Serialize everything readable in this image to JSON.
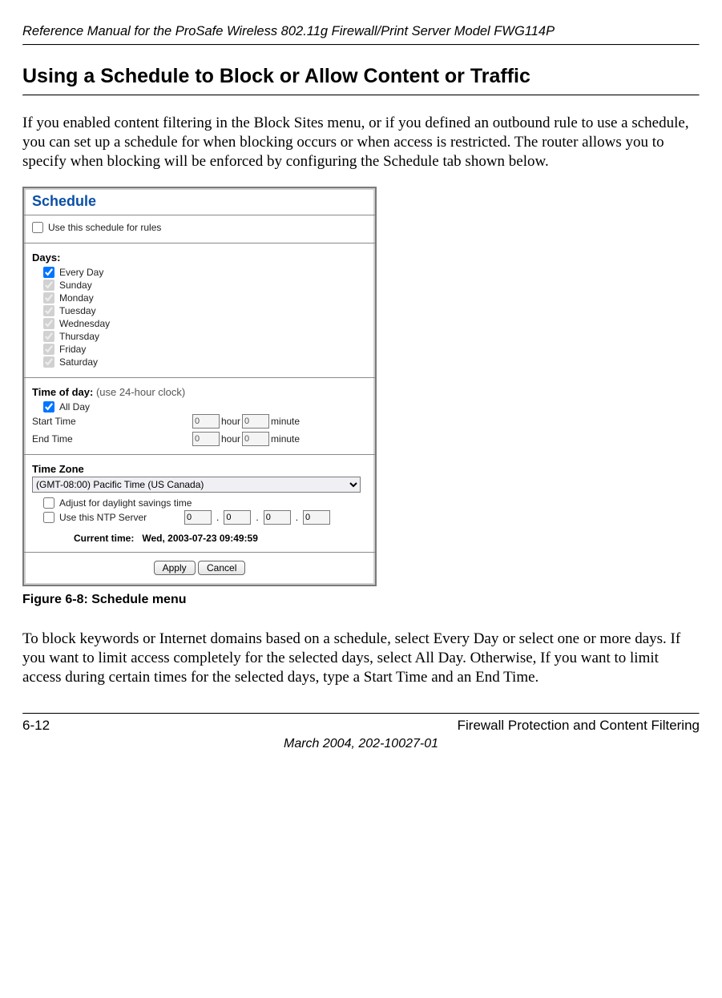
{
  "header": {
    "title": "Reference Manual for the ProSafe Wireless 802.11g  Firewall/Print Server Model FWG114P"
  },
  "section": {
    "heading": "Using a Schedule to Block or Allow Content or Traffic"
  },
  "intro": "If you enabled content filtering in the Block Sites menu, or if you defined an outbound rule to use a schedule, you can set up a schedule for when blocking occurs or when access is restricted. The router allows you to specify when blocking will be enforced by configuring the Schedule tab shown below.",
  "screenshot": {
    "title": "Schedule",
    "use_rule_label": "Use this schedule for rules",
    "use_rule_checked": false,
    "days_header": "Days:",
    "days": [
      {
        "label": "Every Day",
        "checked": true,
        "disabled": false
      },
      {
        "label": "Sunday",
        "checked": true,
        "disabled": true
      },
      {
        "label": "Monday",
        "checked": true,
        "disabled": true
      },
      {
        "label": "Tuesday",
        "checked": true,
        "disabled": true
      },
      {
        "label": "Wednesday",
        "checked": true,
        "disabled": true
      },
      {
        "label": "Thursday",
        "checked": true,
        "disabled": true
      },
      {
        "label": "Friday",
        "checked": true,
        "disabled": true
      },
      {
        "label": "Saturday",
        "checked": true,
        "disabled": true
      }
    ],
    "tod_header": "Time of day:",
    "tod_note": "(use 24-hour clock)",
    "allday_label": "All Day",
    "allday_checked": true,
    "start_label": "Start Time",
    "end_label": "End Time",
    "hour_unit": "hour",
    "minute_unit": "minute",
    "start_hour": "0",
    "start_min": "0",
    "end_hour": "0",
    "end_min": "0",
    "tz_header": "Time Zone",
    "tz_value": "(GMT-08:00) Pacific Time (US Canada)",
    "dst_label": "Adjust for daylight savings time",
    "dst_checked": false,
    "ntp_label": "Use this NTP Server",
    "ntp_checked": false,
    "ntp_ip": [
      "0",
      "0",
      "0",
      "0"
    ],
    "current_label": "Current time:",
    "current_value": "Wed, 2003-07-23 09:49:59",
    "apply_label": "Apply",
    "cancel_label": "Cancel"
  },
  "caption": "Figure 6-8:  Schedule menu",
  "outro": "To block keywords or Internet domains based on a schedule, select Every Day or select one or more days. If you want to limit access completely for the selected days, select All Day. Otherwise, If you want to limit access during certain times for the selected days, type a Start Time and an End Time.",
  "footer": {
    "page": "6-12",
    "chapter": "Firewall Protection and Content Filtering",
    "date": "March 2004, 202-10027-01"
  }
}
